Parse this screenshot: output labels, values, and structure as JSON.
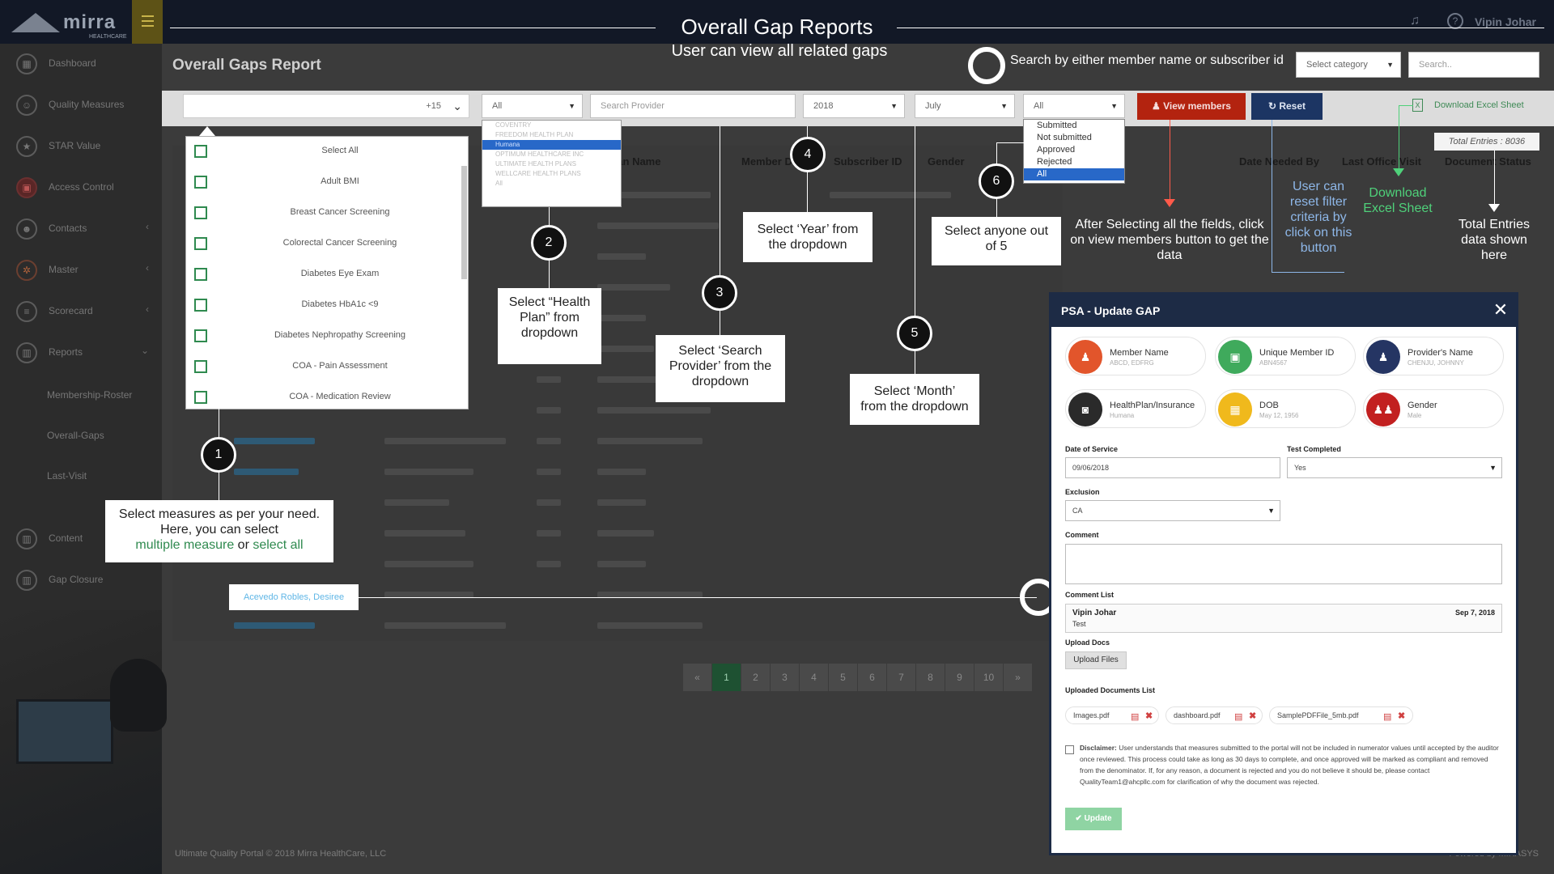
{
  "header": {
    "logo_text": "mirra",
    "logo_sub": "HEALTHCARE",
    "username": "Vipin Johar",
    "bell_icon": "bell-icon",
    "help_icon": "question-circle-icon"
  },
  "sidebar": {
    "items": [
      {
        "label": "Dashboard",
        "icon": "dashboard-icon"
      },
      {
        "label": "Quality Measures",
        "icon": "person-icon"
      },
      {
        "label": "STAR Value",
        "icon": "star-icon"
      },
      {
        "label": "Access Control",
        "icon": "lock-icon"
      },
      {
        "label": "Contacts",
        "icon": "contact-icon"
      },
      {
        "label": "Master",
        "icon": "gear-icon"
      },
      {
        "label": "Scorecard",
        "icon": "list-icon"
      },
      {
        "label": "Reports",
        "icon": "bar-chart-icon"
      }
    ],
    "sub_items": [
      "Membership-Roster",
      "Overall-Gaps",
      "Last-Visit"
    ],
    "bottom_items": [
      {
        "label": "Content",
        "icon": "bar-chart-icon"
      },
      {
        "label": "Gap Closure",
        "icon": "bar-chart-icon"
      }
    ]
  },
  "page": {
    "title": "Overall Gaps Report"
  },
  "filters": {
    "measures_count": "+15",
    "health_plan": "All",
    "provider_placeholder": "Search Provider",
    "year": "2018",
    "month": "July",
    "status": "All",
    "category": "Select category",
    "search_placeholder": "Search..",
    "view_members": "View members",
    "reset": "Reset",
    "download": "Download Excel Sheet",
    "total_entries": "Total Entries : 8036"
  },
  "measures": [
    "Select All",
    "Adult BMI",
    "Breast Cancer Screening",
    "Colorectal Cancer Screening",
    "Diabetes Eye Exam",
    "Diabetes HbA1c <9",
    "Diabetes Nephropathy Screening",
    "COA - Pain Assessment",
    "COA - Medication Review"
  ],
  "health_plans": [
    "COVENTRY",
    "FREEDOM HEALTH PLAN",
    "Humana",
    "OPTIMUM HEALTHCARE INC",
    "ULTIMATE HEALTH PLANS",
    "WELLCARE HEALTH PLANS",
    "All"
  ],
  "statuses": [
    "Submitted",
    "Not submitted",
    "Approved",
    "Rejected",
    "All"
  ],
  "table_headers": [
    "Plan Name",
    "Member DOB",
    "Subscriber ID",
    "Gender",
    "Date Needed By",
    "Last Office Visit",
    "Document Status"
  ],
  "highlighted_member": "Acevedo Robles, Desiree",
  "pager": [
    "«",
    "1",
    "2",
    "3",
    "4",
    "5",
    "6",
    "7",
    "8",
    "9",
    "10",
    "»"
  ],
  "footer": {
    "copyright": "Ultimate Quality Portal © 2018 Mirra HealthCare, LLC",
    "powered": "Powered by MIRASYS"
  },
  "annotations": {
    "title": "Overall Gap Reports",
    "subtitle": "User can view all related gaps",
    "search_hint": "Search by either member name or subscriber id",
    "step1_line1": "Select measures as per your need.",
    "step1_line2": "Here, you can select",
    "step1_multi": "multiple measure",
    "step1_or": " or ",
    "step1_all": "select all",
    "step2": "Select “Health Plan” from dropdown",
    "step3": "Select ‘Search Provider’ from the dropdown",
    "step4": "Select ‘Year’ from the dropdown",
    "step5": "Select ‘Month’ from the dropdown",
    "step6": "Select anyone out of 5",
    "view_note": "After Selecting all the fields, click on view members button to get the data",
    "reset_note": "User can reset filter criteria by click on this button",
    "download_note": "Download Excel Sheet",
    "total_note": "Total Entries data shown here",
    "num1": "1",
    "num2": "2",
    "num3": "3",
    "num4": "4",
    "num5": "5",
    "num6": "6"
  },
  "modal": {
    "title": "PSA - Update GAP",
    "cards": [
      {
        "label": "Member Name",
        "value": "ABCD, EDFRG",
        "color": "#e2552b",
        "icon": "user-icon"
      },
      {
        "label": "Unique Member ID",
        "value": "ABN4567",
        "color": "#3faa5c",
        "icon": "id-card-icon"
      },
      {
        "label": "Provider's Name",
        "value": "CHENJU, JOHNNY",
        "color": "#253563",
        "icon": "doctor-icon"
      },
      {
        "label": "HealthPlan/Insurance",
        "value": "Humana",
        "color": "#2a2a2a",
        "icon": "briefcase-icon"
      },
      {
        "label": "DOB",
        "value": "May 12, 1956",
        "color": "#f0b91c",
        "icon": "calendar-icon"
      },
      {
        "label": "Gender",
        "value": "Male",
        "color": "#c22020",
        "icon": "people-icon"
      }
    ],
    "date_label": "Date of Service",
    "date_value": "09/06/2018",
    "test_label": "Test Completed",
    "test_value": "Yes",
    "exclusion_label": "Exclusion",
    "exclusion_value": "CA",
    "comment_label": "Comment",
    "comment_list_label": "Comment List",
    "comment_name": "Vipin Johar",
    "comment_text": "Test",
    "comment_date": "Sep 7, 2018",
    "upload_label": "Upload Docs",
    "upload_btn": "Upload Files",
    "uploaded_label": "Uploaded Documents List",
    "docs": [
      "Images.pdf",
      "dashboard.pdf",
      "SamplePDFFile_5mb.pdf"
    ],
    "disclaimer_bold": "Disclaimer:",
    "disclaimer": " User understands that measures submitted to the portal will not be included in numerator values until accepted by the auditor once reviewed. This process could take as long as 30 days to complete, and once approved will be marked as compliant and removed from the denominator. If, for any reason, a document is rejected and you do not believe it should be, please contact QualityTeam1@ahcpllc.com for clarification of why the document was rejected.",
    "update_btn": "✔ Update"
  }
}
